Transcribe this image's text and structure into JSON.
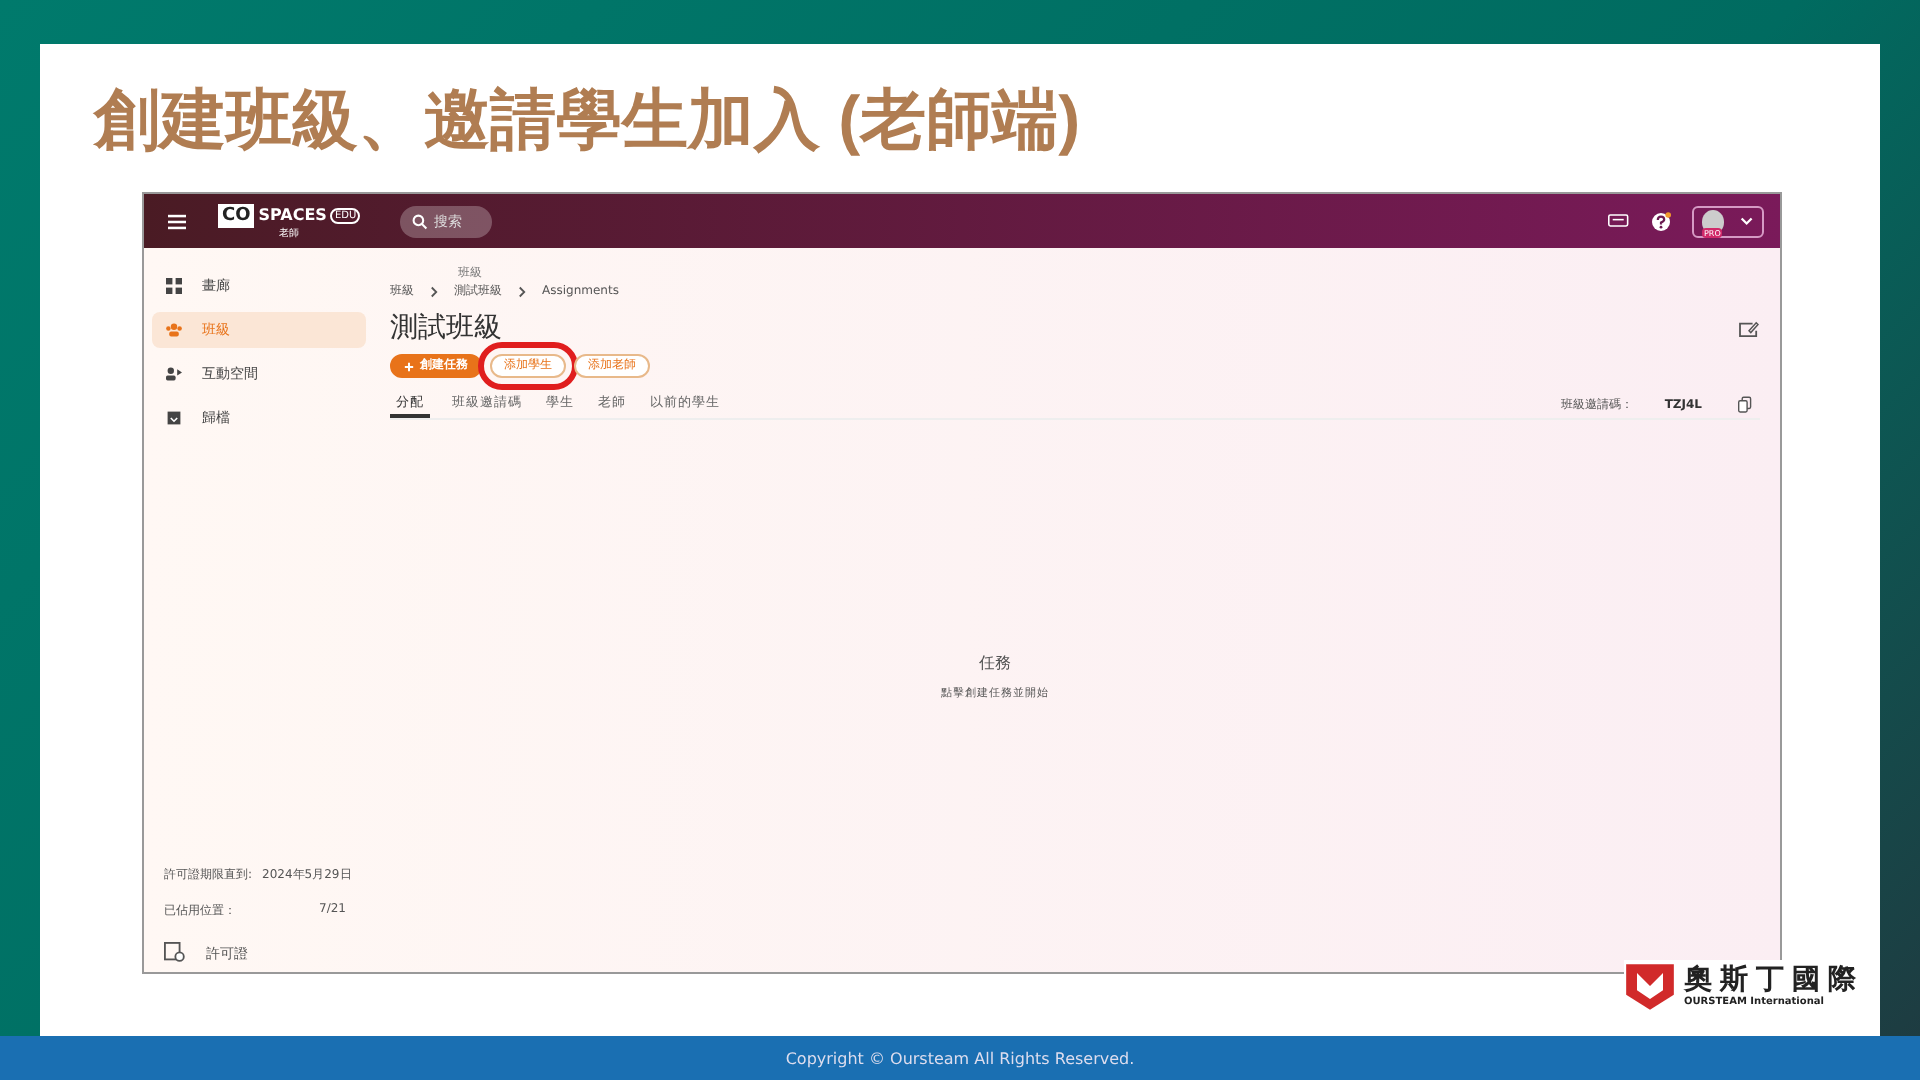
{
  "slide": {
    "title": "創建班級、邀請學生加入 (老師端)",
    "footer": "Copyright © Oursteam All Rights Reserved.",
    "logo": {
      "name": "奧斯丁國際",
      "subtitle": "OURSTEAM International"
    }
  },
  "app": {
    "logo": {
      "brand": "CO",
      "product": "SPACES",
      "badge": "EDU",
      "role": "老師"
    },
    "search": {
      "placeholder": "搜索"
    },
    "account_badge": "PRO",
    "sidebar": {
      "items": [
        {
          "label": "畫廊",
          "selected": false
        },
        {
          "label": "班級",
          "selected": true
        },
        {
          "label": "互動空間",
          "selected": false
        },
        {
          "label": "歸檔",
          "selected": false
        }
      ],
      "license_label": "許可證期限直到:",
      "license_date": "2024年5月29日",
      "seats_label": "已佔用位置：",
      "seats_value": "7/21",
      "license_link": "許可證"
    },
    "breadcrumb": {
      "caption": "班級",
      "items": [
        "班級",
        "測試班級",
        "Assignments"
      ]
    },
    "class_title": "測試班級",
    "actions": [
      {
        "label": "創建任務",
        "kind": "primary",
        "highlighted": false
      },
      {
        "label": "添加學生",
        "kind": "outline",
        "highlighted": true
      },
      {
        "label": "添加老師",
        "kind": "outline",
        "highlighted": false
      }
    ],
    "tabs": [
      {
        "label": "分配",
        "selected": true
      },
      {
        "label": "班級邀請碼",
        "selected": false
      },
      {
        "label": "學生",
        "selected": false
      },
      {
        "label": "老師",
        "selected": false
      },
      {
        "label": "以前的學生",
        "selected": false
      }
    ],
    "invite_code": {
      "label": "班級邀請碼：",
      "value": "TZJ4L"
    },
    "empty_state": {
      "title": "任務",
      "hint": "點擊創建任務並開始"
    }
  }
}
